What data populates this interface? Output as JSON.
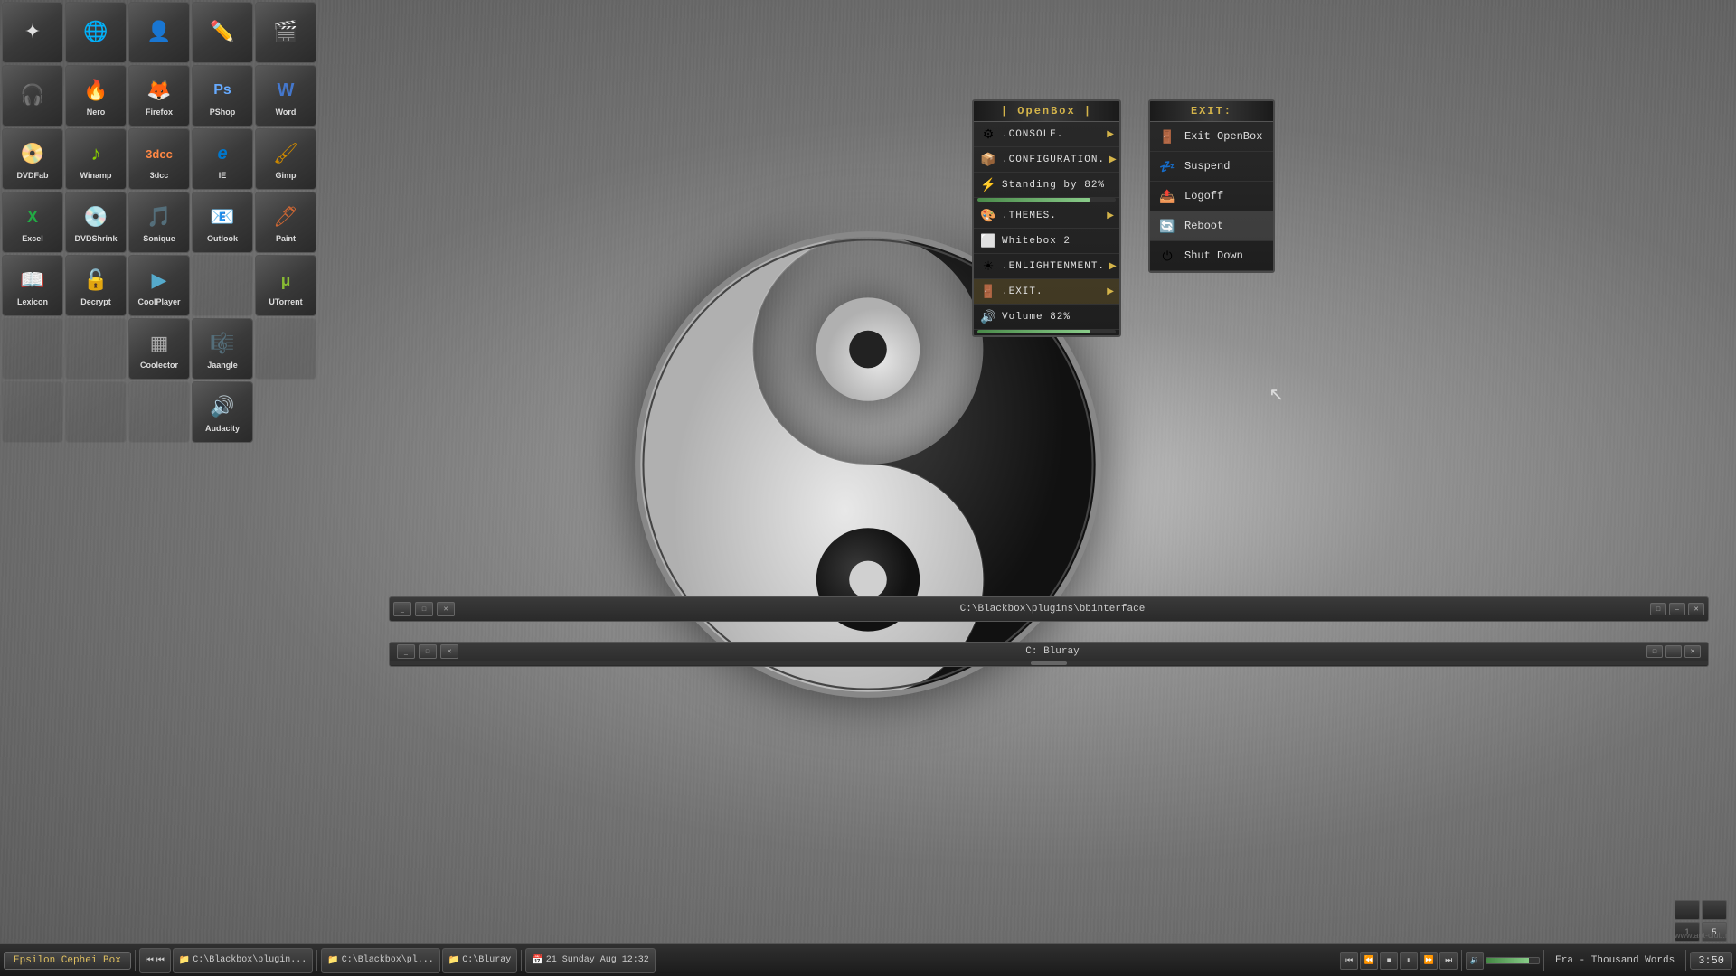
{
  "desktop": {
    "bg_color": "#808080"
  },
  "icons": [
    {
      "id": "share",
      "label": "",
      "symbol": "✦",
      "color": "#e0e0e0"
    },
    {
      "id": "globe",
      "label": "",
      "symbol": "🌐",
      "color": "#4aa8ff"
    },
    {
      "id": "person",
      "label": "",
      "symbol": "👤",
      "color": "#f0c060"
    },
    {
      "id": "edit",
      "label": "",
      "symbol": "✏️",
      "color": "#c0e0ff"
    },
    {
      "id": "video",
      "label": "",
      "symbol": "🎬",
      "color": "#ff6060"
    },
    {
      "id": "headphone",
      "label": "",
      "symbol": "🎧",
      "color": "#c0c0c0"
    },
    {
      "id": "nero",
      "label": "Nero",
      "symbol": "🔥",
      "color": "#ff4444"
    },
    {
      "id": "firefox",
      "label": "Firefox",
      "symbol": "🦊",
      "color": "#ff7700"
    },
    {
      "id": "pshop",
      "label": "PShop",
      "symbol": "Ps",
      "color": "#66aaff"
    },
    {
      "id": "word",
      "label": "Word",
      "symbol": "W",
      "color": "#4477cc"
    },
    {
      "id": "dvdfab",
      "label": "DVDFab",
      "symbol": "📀",
      "color": "#aa44ff"
    },
    {
      "id": "winamp",
      "label": "Winamp",
      "symbol": "♪",
      "color": "#88cc00"
    },
    {
      "id": "3dcc",
      "label": "3dcc",
      "symbol": "3D",
      "color": "#ff8844"
    },
    {
      "id": "ie",
      "label": "IE",
      "symbol": "e",
      "color": "#0077cc"
    },
    {
      "id": "gimp",
      "label": "Gimp",
      "symbol": "🖌",
      "color": "#cc8800"
    },
    {
      "id": "excel",
      "label": "Excel",
      "symbol": "X",
      "color": "#22aa44"
    },
    {
      "id": "dvdshrink",
      "label": "DVDShrink",
      "symbol": "💿",
      "color": "#cc4444"
    },
    {
      "id": "sonique",
      "label": "Sonique",
      "symbol": "🎵",
      "color": "#6644cc"
    },
    {
      "id": "outlook",
      "label": "Outlook",
      "symbol": "📧",
      "color": "#0055bb"
    },
    {
      "id": "paint",
      "label": "Paint",
      "symbol": "🖊",
      "color": "#cc6633"
    },
    {
      "id": "lexicon",
      "label": "Lexicon",
      "symbol": "📖",
      "color": "#886644"
    },
    {
      "id": "decrypt",
      "label": "Decrypt",
      "symbol": "🔓",
      "color": "#aa8833"
    },
    {
      "id": "coolplayer",
      "label": "CoolPlayer",
      "symbol": "▶",
      "color": "#55aacc"
    },
    {
      "id": "utorrent",
      "label": "UTorrent",
      "symbol": "µ",
      "color": "#88bb33"
    },
    {
      "id": "blank1",
      "label": "",
      "symbol": "",
      "color": "#555"
    },
    {
      "id": "coolector",
      "label": "Coolector",
      "symbol": "▦",
      "color": "#aaaaaa"
    },
    {
      "id": "jaangle",
      "label": "Jaangle",
      "symbol": "🎼",
      "color": "#cc7722"
    },
    {
      "id": "blank2",
      "label": "",
      "symbol": "",
      "color": "#555"
    },
    {
      "id": "blank3",
      "label": "",
      "symbol": "",
      "color": "#555"
    },
    {
      "id": "audacity",
      "label": "Audacity",
      "symbol": "🔊",
      "color": "#ee4400"
    }
  ],
  "openbox_menu": {
    "title": "| OpenBox |",
    "items": [
      {
        "id": "console",
        "text": ".CONSOLE.",
        "icon": "⚙",
        "has_arrow": true
      },
      {
        "id": "configuration",
        "text": ".CONFIGURATION.",
        "icon": "📦",
        "has_arrow": true
      },
      {
        "id": "standingby",
        "text": "Standing by  82%",
        "icon": "⚡",
        "progress": 82,
        "has_arrow": false
      },
      {
        "id": "themes",
        "text": ".THEMES.",
        "icon": "🎨",
        "has_arrow": true
      },
      {
        "id": "whitebox2",
        "text": "Whitebox 2",
        "icon": "⬜",
        "has_arrow": false
      },
      {
        "id": "enlightenment",
        "text": ".ENLIGHTENMENT.",
        "icon": "☀",
        "has_arrow": true
      },
      {
        "id": "exit",
        "text": ".EXIT.",
        "icon": "🚪",
        "has_arrow": true,
        "active": true
      },
      {
        "id": "volume",
        "text": "Volume  82%",
        "icon": "🔊",
        "progress": 82,
        "has_arrow": false
      }
    ]
  },
  "exit_menu": {
    "title": "EXIT:",
    "items": [
      {
        "id": "exit-openbox",
        "text": "Exit OpenBox",
        "icon": "🚪"
      },
      {
        "id": "suspend",
        "text": "Suspend",
        "icon": "💤"
      },
      {
        "id": "logoff",
        "text": "Logoff",
        "icon": "📤"
      },
      {
        "id": "reboot",
        "text": "Reboot",
        "icon": "🔄",
        "highlighted": true
      },
      {
        "id": "shutdown",
        "text": "Shut Down",
        "icon": "⏻"
      }
    ]
  },
  "windows": [
    {
      "id": "bbinterface",
      "title": "C:\\Blackbox\\plugins\\bbinterface"
    },
    {
      "id": "bluray",
      "title": "C: Bluray"
    }
  ],
  "taskbar": {
    "start_label": "Epsilon Cephei Box",
    "buttons": [
      {
        "id": "tb-bb1",
        "label": "C:\\Blackbox\\plugin...",
        "icon": "📁"
      },
      {
        "id": "tb-bb2",
        "label": "C:\\Blackbox\\pl...",
        "icon": "📁"
      },
      {
        "id": "tb-bluray",
        "label": "C:\\Bluray",
        "icon": "📁"
      }
    ],
    "datetime": "21 Sunday Aug 12:32",
    "song": "Era - Thousand Words",
    "time": "3:50",
    "volume_pct": 80,
    "media_buttons": [
      "⏮",
      "⏪",
      "⏹",
      "⏸",
      "⏩",
      "⏭",
      "🔉"
    ]
  },
  "workspace": {
    "current": 5,
    "buttons": [
      "",
      "",
      "1",
      "5"
    ]
  },
  "watermark": "www.aot-club.ru"
}
